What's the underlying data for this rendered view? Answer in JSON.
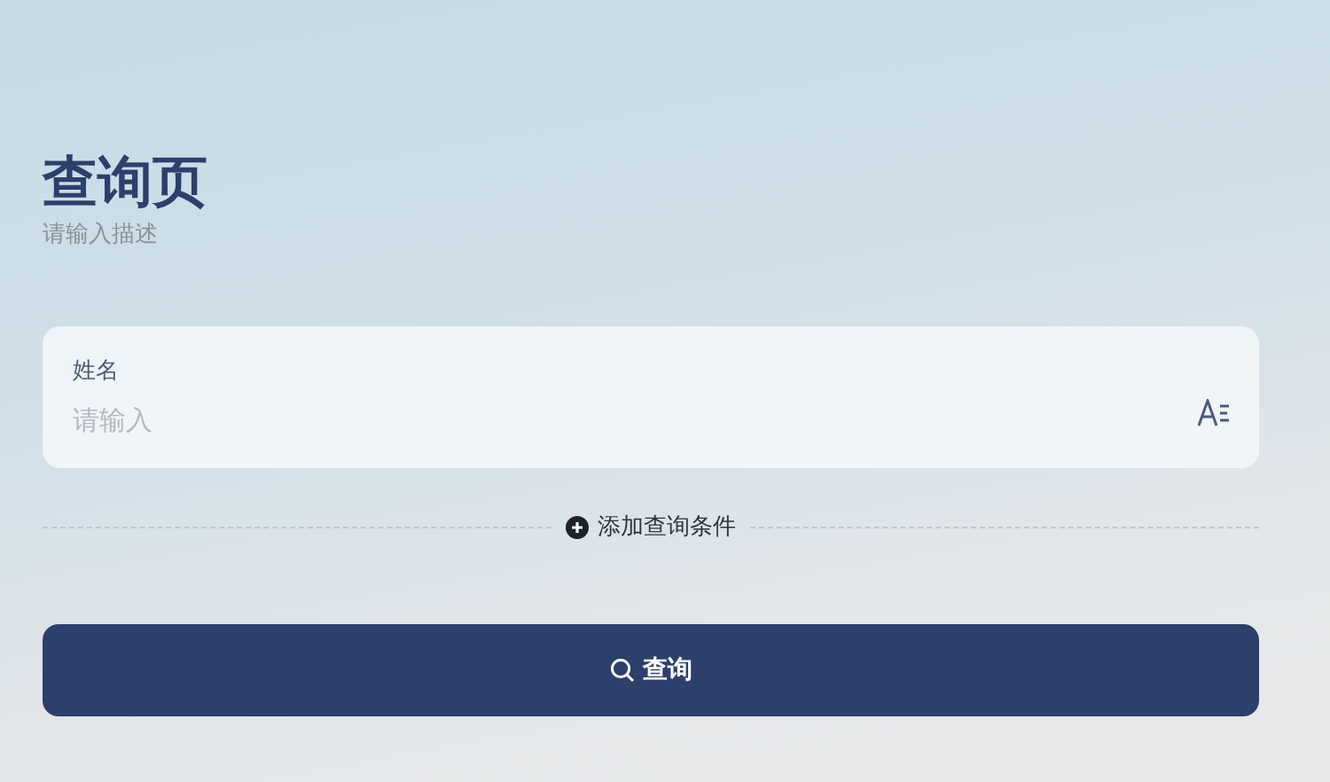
{
  "header": {
    "title": "查询页",
    "description": "请输入描述"
  },
  "fields": [
    {
      "label": "姓名",
      "placeholder": "请输入"
    }
  ],
  "add_condition": {
    "label": "添加查询条件"
  },
  "search_button": {
    "label": "查询"
  }
}
